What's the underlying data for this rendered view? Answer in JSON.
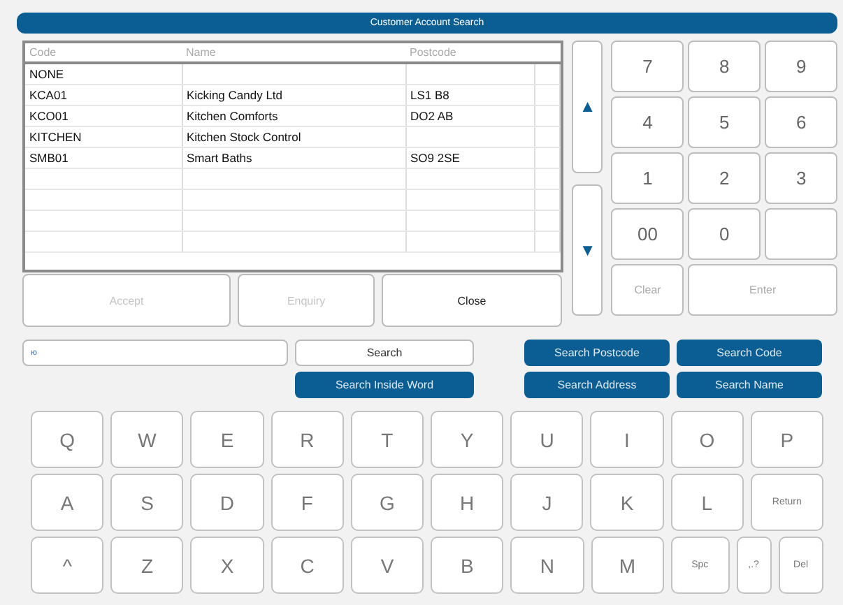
{
  "window": {
    "title": "Customer Account Search"
  },
  "table": {
    "columns": [
      "Code",
      "Name",
      "Postcode"
    ],
    "rows": [
      [
        "NONE",
        "",
        ""
      ],
      [
        "KCA01",
        "Kicking Candy Ltd",
        "LS1 B8"
      ],
      [
        "KCO01",
        "Kitchen Comforts",
        "DO2 AB"
      ],
      [
        "KITCHEN",
        "Kitchen Stock Control",
        ""
      ],
      [
        "SMB01",
        "Smart Baths",
        "SO9 2SE"
      ],
      [
        "",
        "",
        ""
      ],
      [
        "",
        "",
        ""
      ],
      [
        "",
        "",
        ""
      ],
      [
        "",
        "",
        ""
      ]
    ]
  },
  "scroll_buttons": [
    {
      "symbol": "▲"
    },
    {
      "symbol": "▼"
    }
  ],
  "numpad": {
    "keys": [
      "7",
      "8",
      "9",
      "4",
      "5",
      "6",
      "1",
      "2",
      "3",
      "00",
      "0"
    ],
    "clear": {
      "label": "Clear",
      "disabled": true
    },
    "enter": {
      "label": "Enter",
      "disabled": true
    }
  },
  "actions": [
    {
      "label": "Accept",
      "disabled": true
    },
    {
      "label": "Enquiry",
      "disabled": true
    },
    {
      "label": "Close",
      "disabled": false
    }
  ],
  "search": {
    "value": "ю",
    "button": "Search",
    "inside_word": "Search Inside Word"
  },
  "search_modes": [
    "Search Postcode",
    "Search Code",
    "Search Address",
    "Search Name"
  ],
  "keyboard": [
    [
      {
        "label": "Q",
        "kind": "letter"
      },
      {
        "label": "W",
        "kind": "letter"
      },
      {
        "label": "E",
        "kind": "letter"
      },
      {
        "label": "R",
        "kind": "letter"
      },
      {
        "label": "T",
        "kind": "letter"
      },
      {
        "label": "Y",
        "kind": "letter"
      },
      {
        "label": "U",
        "kind": "letter"
      },
      {
        "label": "I",
        "kind": "letter"
      },
      {
        "label": "O",
        "kind": "letter"
      },
      {
        "label": "P",
        "kind": "letter"
      }
    ],
    [
      {
        "label": "A",
        "kind": "letter"
      },
      {
        "label": "S",
        "kind": "letter"
      },
      {
        "label": "D",
        "kind": "letter"
      },
      {
        "label": "F",
        "kind": "letter"
      },
      {
        "label": "G",
        "kind": "letter"
      },
      {
        "label": "H",
        "kind": "letter"
      },
      {
        "label": "J",
        "kind": "letter"
      },
      {
        "label": "K",
        "kind": "letter"
      },
      {
        "label": "L",
        "kind": "letter"
      },
      {
        "label": "Return",
        "kind": "function"
      }
    ],
    [
      {
        "label": "^",
        "kind": "letter"
      },
      {
        "label": "Z",
        "kind": "letter"
      },
      {
        "label": "X",
        "kind": "letter"
      },
      {
        "label": "C",
        "kind": "letter"
      },
      {
        "label": "V",
        "kind": "letter"
      },
      {
        "label": "B",
        "kind": "letter"
      },
      {
        "label": "N",
        "kind": "letter"
      },
      {
        "label": "M",
        "kind": "letter"
      },
      {
        "label": "Spc",
        "kind": "space"
      },
      {
        "label": ",.?",
        "kind": "punctuation"
      },
      {
        "label": "Del",
        "kind": "delete"
      }
    ]
  ]
}
